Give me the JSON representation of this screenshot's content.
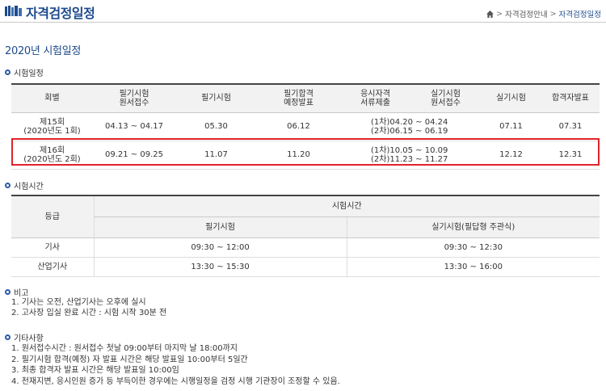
{
  "header": {
    "title": "자격검정일정",
    "breadcrumb": {
      "parent": "자격검정안내",
      "separator": ">",
      "current": "자격검정일정"
    }
  },
  "section_title": "2020년 시험일정",
  "schedule": {
    "heading": "시험일정",
    "columns": [
      "회별",
      "필기시험\n원서접수",
      "필기시험",
      "필기합격\n예정발표",
      "응시자격\n서류제출",
      "실기시험\n원서접수",
      "실기시험",
      "합격자발표"
    ],
    "rows": [
      {
        "round": "제15회\n(2020년도 1회)",
        "written_apply": "04.13 ~ 04.17",
        "written_exam": "05.30",
        "written_result": "06.12",
        "practical_apply": "(1차)04.20 ~ 04.24\n(2차)06.15 ~ 06.19",
        "practical_exam": "07.11",
        "final_result": "07.31"
      },
      {
        "round": "제16회\n(2020년도 2회)",
        "written_apply": "09.21 ~ 09.25",
        "written_exam": "11.07",
        "written_result": "11.20",
        "practical_apply": "(1차)10.05 ~ 10.09\n(2차)11.23 ~ 11.27",
        "practical_exam": "12.12",
        "final_result": "12.31"
      }
    ]
  },
  "exam_time": {
    "heading": "시험시간",
    "grade_header": "등급",
    "time_header": "시험시간",
    "written_header": "필기시험",
    "practical_header": "실기시험(필답형 주관식)",
    "rows": [
      {
        "grade": "기사",
        "written": "09:30 ~ 12:00",
        "practical": "09:30 ~ 12:30"
      },
      {
        "grade": "산업기사",
        "written": "13:30 ~ 15:30",
        "practical": "13:30 ~ 16:00"
      }
    ]
  },
  "remarks": {
    "heading": "비고",
    "items": [
      "1. 기사는 오전, 산업기사는 오후에 실시",
      "2. 고사장 입실 완료 시간 : 시험 시작 30분 전"
    ]
  },
  "others": {
    "heading": "기타사항",
    "items": [
      "1. 원서접수시간 : 원서접수 첫날 09:00부터 마지막 날 18:00까지",
      "2. 필기시험 합격(예정) 자 발표 시간은 해당 발표일 10:00부터 5일간",
      "3. 최종 합격자 발표 시간은 해당 발표일 10:00임",
      "4. 천재지변, 응시인원 증가 등 부득이한 경우에는 시행일정을 검정 시행 기관장이 조정할 수 있음."
    ]
  },
  "colors": {
    "title_blue": "#1d4a8c",
    "highlight_red": "#e0232a",
    "header_bg": "#f2f2f2"
  },
  "icons": {
    "logo": "book-icon",
    "home": "home-icon",
    "bullet": "circle-bullet-icon"
  }
}
